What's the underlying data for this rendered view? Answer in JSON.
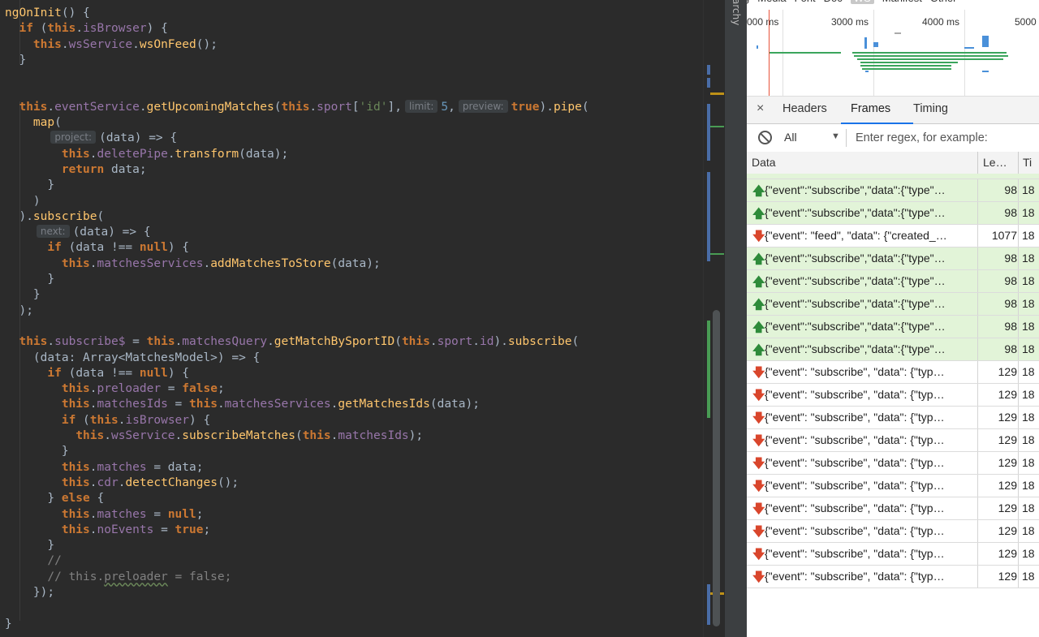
{
  "editor": {
    "lines": [
      [
        [
          "fn",
          "ngOnInit"
        ],
        [
          "df",
          "() {"
        ]
      ],
      [
        [
          "df",
          "  "
        ],
        [
          "kw",
          "if"
        ],
        [
          "df",
          " ("
        ],
        [
          "kw",
          "this"
        ],
        [
          "df",
          "."
        ],
        [
          "pr",
          "isBrowser"
        ],
        [
          "df",
          ") {"
        ]
      ],
      [
        [
          "df",
          "    "
        ],
        [
          "kw",
          "this"
        ],
        [
          "df",
          "."
        ],
        [
          "pr",
          "wsService"
        ],
        [
          "df",
          "."
        ],
        [
          "fn",
          "wsOnFeed"
        ],
        [
          "df",
          "();"
        ]
      ],
      [
        [
          "df",
          "  }"
        ]
      ],
      [],
      [],
      [
        [
          "df",
          "  "
        ],
        [
          "kw",
          "this"
        ],
        [
          "df",
          "."
        ],
        [
          "pr",
          "eventService"
        ],
        [
          "df",
          "."
        ],
        [
          "fn",
          "getUpcomingMatches"
        ],
        [
          "df",
          "("
        ],
        [
          "kw",
          "this"
        ],
        [
          "df",
          "."
        ],
        [
          "pr",
          "sport"
        ],
        [
          "df",
          "["
        ],
        [
          "st",
          "'id'"
        ],
        [
          "df",
          "],"
        ],
        [
          "hint",
          "limit:"
        ],
        [
          "nm",
          "5"
        ],
        [
          "df",
          ","
        ],
        [
          "hint",
          "preview:"
        ],
        [
          "kw",
          "true"
        ],
        [
          "df",
          ")."
        ],
        [
          "fn",
          "pipe"
        ],
        [
          "df",
          "("
        ]
      ],
      [
        [
          "df",
          "    "
        ],
        [
          "fn",
          "map"
        ],
        [
          "df",
          "("
        ]
      ],
      [
        [
          "df",
          "      "
        ],
        [
          "hint",
          "project:"
        ],
        [
          "df",
          "(data) => {"
        ]
      ],
      [
        [
          "df",
          "        "
        ],
        [
          "kw",
          "this"
        ],
        [
          "df",
          "."
        ],
        [
          "pr",
          "deletePipe"
        ],
        [
          "df",
          "."
        ],
        [
          "fn",
          "transform"
        ],
        [
          "df",
          "(data);"
        ]
      ],
      [
        [
          "df",
          "        "
        ],
        [
          "kw",
          "return"
        ],
        [
          "df",
          " data;"
        ]
      ],
      [
        [
          "df",
          "      }"
        ]
      ],
      [
        [
          "df",
          "    )"
        ]
      ],
      [
        [
          "df",
          "  )."
        ],
        [
          "fn",
          "subscribe"
        ],
        [
          "df",
          "("
        ]
      ],
      [
        [
          "df",
          "    "
        ],
        [
          "hint",
          "next:"
        ],
        [
          "df",
          "(data) => {"
        ]
      ],
      [
        [
          "df",
          "      "
        ],
        [
          "kw",
          "if"
        ],
        [
          "df",
          " (data !== "
        ],
        [
          "kw",
          "null"
        ],
        [
          "df",
          ") {"
        ]
      ],
      [
        [
          "df",
          "        "
        ],
        [
          "kw",
          "this"
        ],
        [
          "df",
          "."
        ],
        [
          "pr",
          "matchesServices"
        ],
        [
          "df",
          "."
        ],
        [
          "fn",
          "addMatchesToStore"
        ],
        [
          "df",
          "(data);"
        ]
      ],
      [
        [
          "df",
          "      }"
        ]
      ],
      [
        [
          "df",
          "    }"
        ]
      ],
      [
        [
          "df",
          "  );"
        ]
      ],
      [],
      [
        [
          "df",
          "  "
        ],
        [
          "kw",
          "this"
        ],
        [
          "df",
          "."
        ],
        [
          "pr",
          "subscribe$"
        ],
        [
          "df",
          " = "
        ],
        [
          "kw",
          "this"
        ],
        [
          "df",
          "."
        ],
        [
          "pr",
          "matchesQuery"
        ],
        [
          "df",
          "."
        ],
        [
          "fn",
          "getMatchBySportID"
        ],
        [
          "df",
          "("
        ],
        [
          "kw",
          "this"
        ],
        [
          "df",
          "."
        ],
        [
          "pr",
          "sport"
        ],
        [
          "df",
          "."
        ],
        [
          "pr",
          "id"
        ],
        [
          "df",
          ")."
        ],
        [
          "fn",
          "subscribe"
        ],
        [
          "df",
          "("
        ]
      ],
      [
        [
          "df",
          "    (data: Array<MatchesModel>) => {"
        ]
      ],
      [
        [
          "df",
          "      "
        ],
        [
          "kw",
          "if"
        ],
        [
          "df",
          " (data !== "
        ],
        [
          "kw",
          "null"
        ],
        [
          "df",
          ") {"
        ]
      ],
      [
        [
          "df",
          "        "
        ],
        [
          "kw",
          "this"
        ],
        [
          "df",
          "."
        ],
        [
          "pr",
          "preloader"
        ],
        [
          "df",
          " = "
        ],
        [
          "kw",
          "false"
        ],
        [
          "df",
          ";"
        ]
      ],
      [
        [
          "df",
          "        "
        ],
        [
          "kw",
          "this"
        ],
        [
          "df",
          "."
        ],
        [
          "pr",
          "matchesIds"
        ],
        [
          "df",
          " = "
        ],
        [
          "kw",
          "this"
        ],
        [
          "df",
          "."
        ],
        [
          "pr",
          "matchesServices"
        ],
        [
          "df",
          "."
        ],
        [
          "fn",
          "getMatchesIds"
        ],
        [
          "df",
          "(data);"
        ]
      ],
      [
        [
          "df",
          "        "
        ],
        [
          "kw",
          "if"
        ],
        [
          "df",
          " ("
        ],
        [
          "kw",
          "this"
        ],
        [
          "df",
          "."
        ],
        [
          "pr",
          "isBrowser"
        ],
        [
          "df",
          ") {"
        ]
      ],
      [
        [
          "df",
          "          "
        ],
        [
          "kw",
          "this"
        ],
        [
          "df",
          "."
        ],
        [
          "pr",
          "wsService"
        ],
        [
          "df",
          "."
        ],
        [
          "fn",
          "subscribeMatches"
        ],
        [
          "df",
          "("
        ],
        [
          "kw",
          "this"
        ],
        [
          "df",
          "."
        ],
        [
          "pr",
          "matchesIds"
        ],
        [
          "df",
          ");"
        ]
      ],
      [
        [
          "df",
          "        }"
        ]
      ],
      [
        [
          "df",
          "        "
        ],
        [
          "kw",
          "this"
        ],
        [
          "df",
          "."
        ],
        [
          "pr",
          "matches"
        ],
        [
          "df",
          " = data;"
        ]
      ],
      [
        [
          "df",
          "        "
        ],
        [
          "kw",
          "this"
        ],
        [
          "df",
          "."
        ],
        [
          "pr",
          "cdr"
        ],
        [
          "df",
          "."
        ],
        [
          "fn",
          "detectChanges"
        ],
        [
          "df",
          "();"
        ]
      ],
      [
        [
          "df",
          "      } "
        ],
        [
          "kw",
          "else"
        ],
        [
          "df",
          " {"
        ]
      ],
      [
        [
          "df",
          "        "
        ],
        [
          "kw",
          "this"
        ],
        [
          "df",
          "."
        ],
        [
          "pr",
          "matches"
        ],
        [
          "df",
          " = "
        ],
        [
          "kw",
          "null"
        ],
        [
          "df",
          ";"
        ]
      ],
      [
        [
          "df",
          "        "
        ],
        [
          "kw",
          "this"
        ],
        [
          "df",
          "."
        ],
        [
          "pr",
          "noEvents"
        ],
        [
          "df",
          " = "
        ],
        [
          "kw",
          "true"
        ],
        [
          "df",
          ";"
        ]
      ],
      [
        [
          "df",
          "      }"
        ]
      ],
      [
        [
          "cm",
          "      //"
        ]
      ],
      [
        [
          "cm",
          "      // this."
        ],
        [
          "cmsq",
          "preloader"
        ],
        [
          "cm",
          " = false;"
        ]
      ],
      [
        [
          "df",
          "    });"
        ]
      ],
      [],
      [
        [
          "df",
          "}"
        ]
      ]
    ]
  },
  "sidebar_label": "archy",
  "devtools": {
    "top_tabs": [
      {
        "label": "g",
        "active": false
      },
      {
        "label": "Media",
        "active": false
      },
      {
        "label": "Font",
        "active": false
      },
      {
        "label": "Doc",
        "active": false
      },
      {
        "label": "WS",
        "active": true
      },
      {
        "label": "Manifest",
        "active": false
      },
      {
        "label": "Other",
        "active": false
      }
    ],
    "timeline_ticks": [
      "000 ms",
      "3000 ms",
      "4000 ms",
      "5000"
    ],
    "detail_tabs": {
      "close": "×",
      "headers": "Headers",
      "frames": "Frames",
      "timing": "Timing"
    },
    "filter": {
      "select": "All",
      "arrow": "▼",
      "placeholder": "Enter regex, for example:"
    },
    "table": {
      "col_data": "Data",
      "col_length": "Le…",
      "col_time": "Ti",
      "rows": [
        {
          "dir": "sent",
          "text": "{\"event\":\"subscribe\",\"data\":{\"type\"…",
          "len": "98",
          "time": "18"
        },
        {
          "dir": "sent",
          "text": "{\"event\":\"subscribe\",\"data\":{\"type\"…",
          "len": "98",
          "time": "18"
        },
        {
          "dir": "recv",
          "text": "{\"event\": \"feed\", \"data\": {\"created_…",
          "len": "1077",
          "time": "18"
        },
        {
          "dir": "sent",
          "text": "{\"event\":\"subscribe\",\"data\":{\"type\"…",
          "len": "98",
          "time": "18"
        },
        {
          "dir": "sent",
          "text": "{\"event\":\"subscribe\",\"data\":{\"type\"…",
          "len": "98",
          "time": "18"
        },
        {
          "dir": "sent",
          "text": "{\"event\":\"subscribe\",\"data\":{\"type\"…",
          "len": "98",
          "time": "18"
        },
        {
          "dir": "sent",
          "text": "{\"event\":\"subscribe\",\"data\":{\"type\"…",
          "len": "98",
          "time": "18"
        },
        {
          "dir": "sent",
          "text": "{\"event\":\"subscribe\",\"data\":{\"type\"…",
          "len": "98",
          "time": "18"
        },
        {
          "dir": "recv",
          "text": "{\"event\": \"subscribe\", \"data\": {\"typ…",
          "len": "129",
          "time": "18"
        },
        {
          "dir": "recv",
          "text": "{\"event\": \"subscribe\", \"data\": {\"typ…",
          "len": "129",
          "time": "18"
        },
        {
          "dir": "recv",
          "text": "{\"event\": \"subscribe\", \"data\": {\"typ…",
          "len": "129",
          "time": "18"
        },
        {
          "dir": "recv",
          "text": "{\"event\": \"subscribe\", \"data\": {\"typ…",
          "len": "129",
          "time": "18"
        },
        {
          "dir": "recv",
          "text": "{\"event\": \"subscribe\", \"data\": {\"typ…",
          "len": "129",
          "time": "18"
        },
        {
          "dir": "recv",
          "text": "{\"event\": \"subscribe\", \"data\": {\"typ…",
          "len": "129",
          "time": "18"
        },
        {
          "dir": "recv",
          "text": "{\"event\": \"subscribe\", \"data\": {\"typ…",
          "len": "129",
          "time": "18"
        },
        {
          "dir": "recv",
          "text": "{\"event\": \"subscribe\", \"data\": {\"typ…",
          "len": "129",
          "time": "18"
        },
        {
          "dir": "recv",
          "text": "{\"event\": \"subscribe\", \"data\": {\"typ…",
          "len": "129",
          "time": "18"
        },
        {
          "dir": "recv",
          "text": "{\"event\": \"subscribe\", \"data\": {\"typ…",
          "len": "129",
          "time": "18"
        }
      ]
    },
    "arrows": {
      "sent": "🡅",
      "recv": "🡇"
    }
  }
}
